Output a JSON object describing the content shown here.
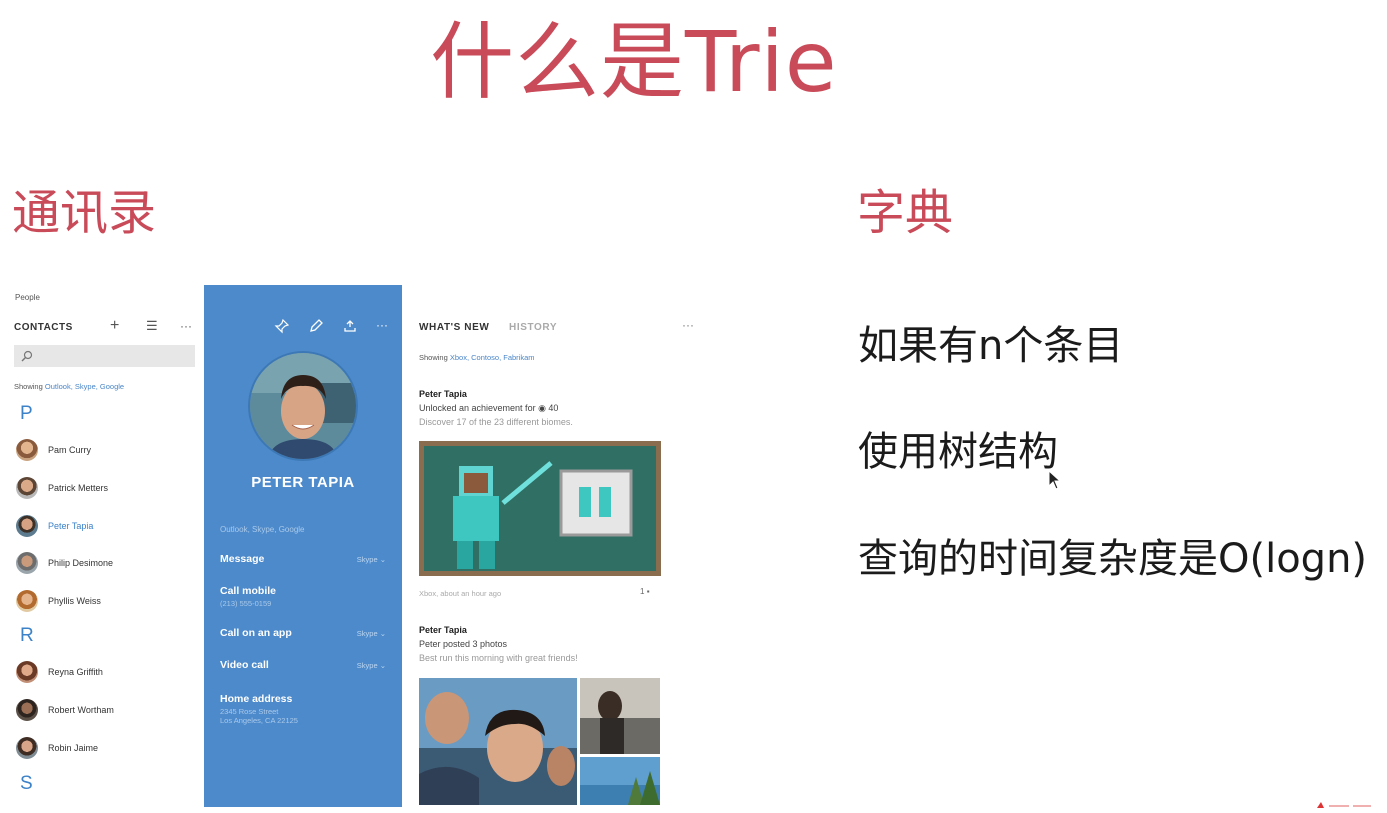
{
  "slide": {
    "title": "什么是Trie",
    "heading_left": "通讯录",
    "heading_right": "字典",
    "bullets": [
      "如果有n个条目",
      "使用树结构",
      "查询的时间复杂度是O(logn)"
    ]
  },
  "app": {
    "name": "People",
    "contacts_header": "CONTACTS",
    "header_icons": [
      "plus-icon",
      "list-icon",
      "more-icon"
    ],
    "showing_label": "Showing",
    "showing_sources": "Outlook, Skype, Google",
    "groups": [
      {
        "letter": "P",
        "contacts": [
          "Pam Curry",
          "Patrick Metters",
          "Peter Tapia",
          "Philip Desimone",
          "Phyllis Weiss"
        ]
      },
      {
        "letter": "R",
        "contacts": [
          "Reyna Griffith",
          "Robert Wortham",
          "Robin Jaime"
        ]
      },
      {
        "letter": "S",
        "contacts": []
      }
    ],
    "selected_contact": "Peter Tapia",
    "profile": {
      "toolbar_icons": [
        "pin-icon",
        "edit-icon",
        "share-icon",
        "more-icon"
      ],
      "name": "PETER TAPIA",
      "sources": "Outlook, Skype, Google",
      "actions": [
        {
          "title": "Message",
          "sub": "",
          "right": "Skype ⌄"
        },
        {
          "title": "Call mobile",
          "sub": "(213) 555-0159",
          "right": ""
        },
        {
          "title": "Call on an app",
          "sub": "",
          "right": "Skype ⌄"
        },
        {
          "title": "Video call",
          "sub": "",
          "right": "Skype ⌄"
        },
        {
          "title": "Home address",
          "sub": "2345 Rose Street",
          "sub2": "Los Angeles, CA 22125",
          "right": ""
        }
      ]
    },
    "feed": {
      "tab_active": "WHAT'S NEW",
      "tab_inactive": "HISTORY",
      "showing_label": "Showing",
      "showing_sources": "Xbox, Contoso, Fabrikam",
      "posts": [
        {
          "name": "Peter Tapia",
          "line": "Unlocked an achievement for ◉ 40",
          "sub": "Discover 17 of the 23 different biomes.",
          "meta": "Xbox, about an hour ago",
          "count": "1"
        },
        {
          "name": "Peter Tapia",
          "line": "Peter posted 3 photos",
          "sub": "Best run this morning with great friends!"
        }
      ]
    }
  },
  "colors": {
    "accent_red": "#c94a58",
    "profile_blue": "#4d8acb",
    "link_blue": "#3c82c9"
  }
}
